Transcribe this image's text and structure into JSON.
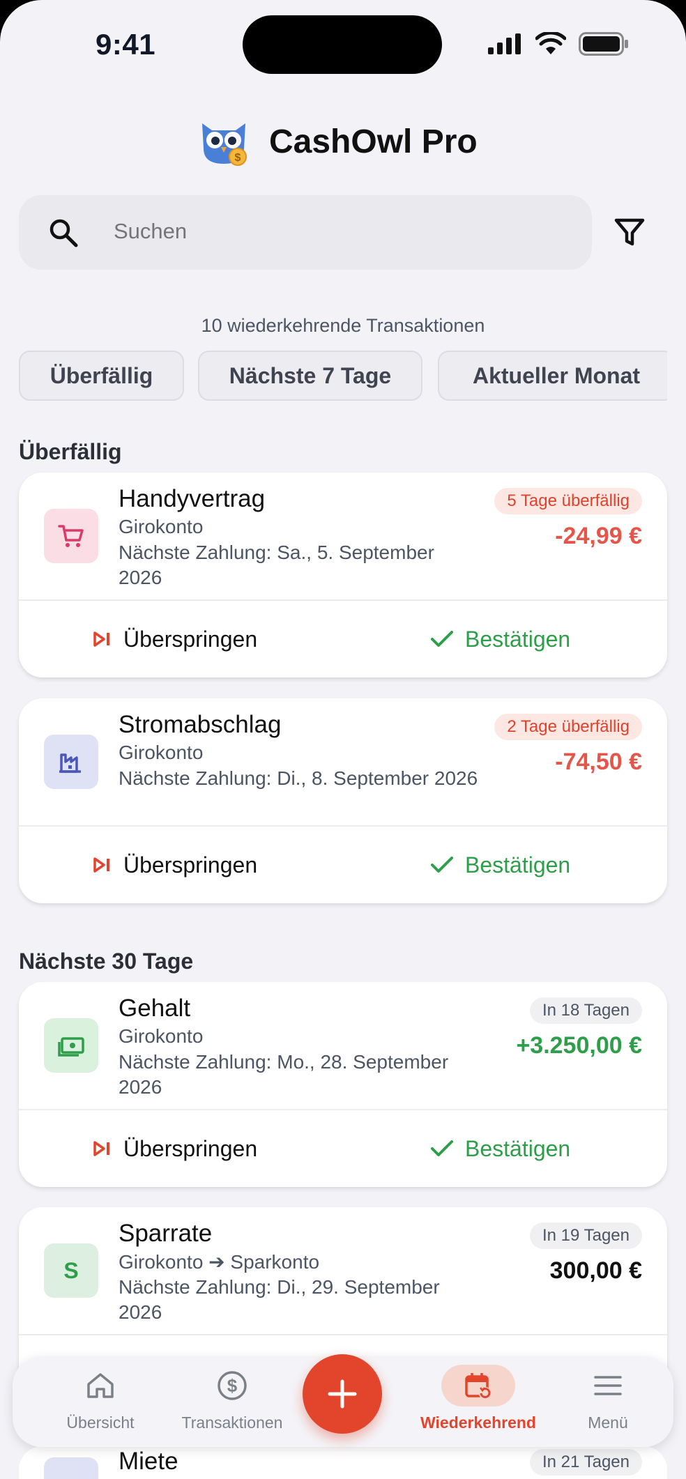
{
  "status_bar": {
    "time": "9:41"
  },
  "app": {
    "title": "CashOwl Pro"
  },
  "search": {
    "placeholder": "Suchen",
    "value": ""
  },
  "summary": {
    "count_text": "10 wiederkehrende Transaktionen"
  },
  "chips": [
    "Überfällig",
    "Nächste 7 Tage",
    "Aktueller Monat"
  ],
  "sections": {
    "overdue": "Überfällig",
    "next30": "Nächste 30 Tage"
  },
  "transactions": [
    {
      "name": "Handyvertrag",
      "account": "Girokonto",
      "next_payment": "Nächste Zahlung: Sa., 5. September 2026",
      "badge": "5 Tage überfällig",
      "amount": "-24,99 €",
      "icon": "shopping-cart-icon",
      "skip": "Überspringen",
      "confirm": "Bestätigen"
    },
    {
      "name": "Stromabschlag",
      "account": "Girokonto",
      "next_payment": "Nächste Zahlung: Di., 8. September 2026",
      "badge": "2 Tage überfällig",
      "amount": "-74,50 €",
      "icon": "factory-icon",
      "skip": "Überspringen",
      "confirm": "Bestätigen"
    },
    {
      "name": "Gehalt",
      "account": "Girokonto",
      "next_payment": "Nächste Zahlung: Mo., 28. September 2026",
      "badge": "In 18 Tagen",
      "amount": "+3.250,00 €",
      "icon": "money-icon",
      "skip": "Überspringen",
      "confirm": "Bestätigen"
    },
    {
      "name": "Sparrate",
      "account": "Girokonto ➔ Sparkonto",
      "next_payment": "Nächste Zahlung: Di., 29. September 2026",
      "badge": "In 19 Tagen",
      "amount": "300,00 €",
      "icon_letter": "S"
    },
    {
      "name": "Miete",
      "badge": "In 21 Tagen"
    }
  ],
  "nav": {
    "overview": "Übersicht",
    "transactions": "Transaktionen",
    "recurring": "Wiederkehrend",
    "menu": "Menü"
  },
  "colors": {
    "accent": "#e2452c",
    "negative": "#e5564a",
    "positive": "#2e9e4a",
    "background": "#f2f2f7"
  }
}
